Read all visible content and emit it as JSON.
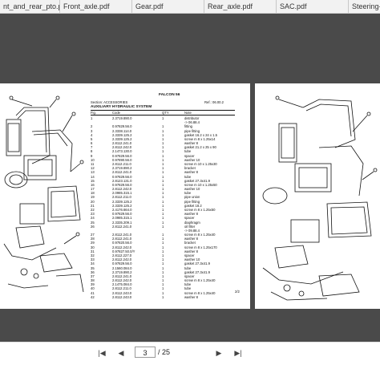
{
  "tabs": [
    {
      "label": "nt_and_rear_pto.pdf"
    },
    {
      "label": "Front_axle.pdf"
    },
    {
      "label": "Gear.pdf"
    },
    {
      "label": "Rear_axle.pdf"
    },
    {
      "label": "SAC.pdf"
    },
    {
      "label": "Steering-sy"
    }
  ],
  "page": {
    "model": "FALCON 56",
    "section_label": "Section: ACCESSORIES",
    "ref_label": "Ref.: 06.00.2",
    "title": "AUXILIARY HYDRAULIC SYSTEM",
    "col_fig": "Fig.",
    "col_code": "Code",
    "col_qty": "QTY",
    "col_desc": "Note",
    "page_number": "2/2",
    "rows": [
      {
        "fig": "1",
        "code": "2.3719.890.0",
        "qty": "1",
        "desc": "distributor"
      },
      {
        "fig": "",
        "code": "",
        "qty": "",
        "desc": "-> 06.88.4"
      },
      {
        "fig": "2",
        "code": "0.97829.56.0",
        "qty": "1",
        "desc": "fitting"
      },
      {
        "fig": "3",
        "code": "2.3338.114.0",
        "qty": "1",
        "desc": "pipe fitting"
      },
      {
        "fig": "4",
        "code": "2.3339.125.2",
        "qty": "1",
        "desc": "gasket 16.2 x 24 x 1.5"
      },
      {
        "fig": "5",
        "code": "2.3339.125.2",
        "qty": "1",
        "desc": "screw m 8 x 1.25x14"
      },
      {
        "fig": "6",
        "code": "2.8112.241.0",
        "qty": "1",
        "desc": "washer 8"
      },
      {
        "fig": "7",
        "code": "2.8112.242.0",
        "qty": "1",
        "desc": "gasket 21.2 x 25 x 90"
      },
      {
        "fig": "8",
        "code": "2.1473.130.0",
        "qty": "1",
        "desc": "tube"
      },
      {
        "fig": "9",
        "code": "0.97829.56.0",
        "qty": "1",
        "desc": "spacer"
      },
      {
        "fig": "10",
        "code": "0.97890.56.0",
        "qty": "1",
        "desc": "washer 10"
      },
      {
        "fig": "11",
        "code": "2.8112.211.0",
        "qty": "1",
        "desc": "screw m 10 x 1.25x30"
      },
      {
        "fig": "12",
        "code": "2.3719.890.2",
        "qty": "1",
        "desc": "bracket"
      },
      {
        "fig": "13",
        "code": "2.8112.241.0",
        "qty": "1",
        "desc": "washer 8"
      },
      {
        "fig": "14",
        "code": "0.97829.56.0",
        "qty": "1",
        "desc": "tube"
      },
      {
        "fig": "15",
        "code": "2.8123.131.0",
        "qty": "1",
        "desc": "gasket 27.3x41.9"
      },
      {
        "fig": "16",
        "code": "0.97829.56.0",
        "qty": "1",
        "desc": "screw m 10 x 1.25x50"
      },
      {
        "fig": "17",
        "code": "2.8112.242.0",
        "qty": "1",
        "desc": "washer 10"
      },
      {
        "fig": "18",
        "code": "2.0985.315.1",
        "qty": "1",
        "desc": "tube"
      },
      {
        "fig": "19",
        "code": "2.8112.211.0",
        "qty": "1",
        "desc": "pipe union"
      },
      {
        "fig": "20",
        "code": "2.3339.125.2",
        "qty": "1",
        "desc": "pipe fitting"
      },
      {
        "fig": "21",
        "code": "2.3339.125.2",
        "qty": "1",
        "desc": "gasket 18.2"
      },
      {
        "fig": "22",
        "code": "2.4176.664.0",
        "qty": "1",
        "desc": "screw m 8 x 1.25x50"
      },
      {
        "fig": "23",
        "code": "0.97829.56.0",
        "qty": "1",
        "desc": "washer 8"
      },
      {
        "fig": "24",
        "code": "2.0985.315.1",
        "qty": "1",
        "desc": "spacer"
      },
      {
        "fig": "25",
        "code": "2.3335.209.1",
        "qty": "1",
        "desc": "diaphragm"
      },
      {
        "fig": "26",
        "code": "2.8112.241.0",
        "qty": "1",
        "desc": "oil filter"
      },
      {
        "fig": "",
        "code": "",
        "qty": "",
        "desc": "-> 09.88.4"
      },
      {
        "fig": "27",
        "code": "2.8112.241.0",
        "qty": "1",
        "desc": "screw m 8 x 1.25x40"
      },
      {
        "fig": "28",
        "code": "2.8112.241.0",
        "qty": "1",
        "desc": "washer 8"
      },
      {
        "fig": "29",
        "code": "0.97820.56.0",
        "qty": "1",
        "desc": "bracket"
      },
      {
        "fig": "30",
        "code": "2.8112.242.0",
        "qty": "1",
        "desc": "screw m 8 x 1.25x170"
      },
      {
        "fig": "31",
        "code": "0.97827.50.0/Y",
        "qty": "1",
        "desc": "washer 8"
      },
      {
        "fig": "32",
        "code": "2.8112.227.0",
        "qty": "1",
        "desc": "spacer"
      },
      {
        "fig": "33",
        "code": "2.8112.242.0",
        "qty": "1",
        "desc": "washer 10"
      },
      {
        "fig": "34",
        "code": "0.97829.56.0",
        "qty": "1",
        "desc": "gasket 27.3x41.9"
      },
      {
        "fig": "35",
        "code": "2.1560.084.0",
        "qty": "1",
        "desc": "tube"
      },
      {
        "fig": "36",
        "code": "2.3719.890.2",
        "qty": "1",
        "desc": "gasket 27.3x41.9"
      },
      {
        "fig": "37",
        "code": "2.8112.241.0",
        "qty": "1",
        "desc": "spacer"
      },
      {
        "fig": "38",
        "code": "2.8112.242.0",
        "qty": "1",
        "desc": "screw m 8 x 1.25x40"
      },
      {
        "fig": "39",
        "code": "2.1475.084.0",
        "qty": "1",
        "desc": "tube"
      },
      {
        "fig": "40",
        "code": "2.8112.211.0",
        "qty": "1",
        "desc": "tube"
      },
      {
        "fig": "41",
        "code": "2.8112.243.0",
        "qty": "1",
        "desc": "screw m 8 x 1.25x40"
      },
      {
        "fig": "42",
        "code": "2.8112.243.0",
        "qty": "1",
        "desc": "washer 8"
      }
    ]
  },
  "nav": {
    "current_page": "3",
    "total_pages": "/ 25",
    "first": "|◀",
    "prev": "◀",
    "next": "▶",
    "last": "▶|"
  }
}
